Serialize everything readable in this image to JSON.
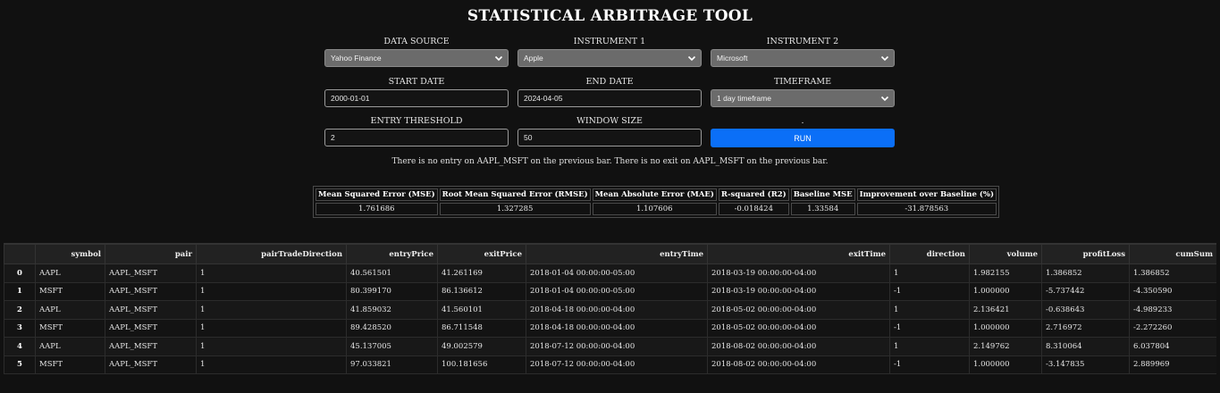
{
  "title": "STATISTICAL ARBITRAGE TOOL",
  "form": {
    "data_source": {
      "label": "DATA SOURCE",
      "value": "Yahoo Finance"
    },
    "instrument1": {
      "label": "INSTRUMENT 1",
      "value": "Apple"
    },
    "instrument2": {
      "label": "INSTRUMENT 2",
      "value": "Microsoft"
    },
    "start_date": {
      "label": "START DATE",
      "value": "2000-01-01"
    },
    "end_date": {
      "label": "END DATE",
      "value": "2024-04-05"
    },
    "timeframe": {
      "label": "TIMEFRAME",
      "value": "1 day timeframe"
    },
    "entry_threshold": {
      "label": "ENTRY THRESHOLD",
      "value": "2"
    },
    "window_size": {
      "label": "WINDOW SIZE",
      "value": "50"
    },
    "run": {
      "label": ".",
      "button": "RUN"
    }
  },
  "status": "There is no entry on AAPL_MSFT on the previous bar. There is no exit on AAPL_MSFT on the previous bar.",
  "metrics": {
    "headers": [
      "Mean Squared Error (MSE)",
      "Root Mean Squared Error (RMSE)",
      "Mean Absolute Error (MAE)",
      "R-squared (R2)",
      "Baseline MSE",
      "Improvement over Baseline (%)"
    ],
    "values": [
      "1.761686",
      "1.327285",
      "1.107606",
      "-0.018424",
      "1.33584",
      "-31.878563"
    ]
  },
  "trades": {
    "columns": [
      "",
      "symbol",
      "pair",
      "pairTradeDirection",
      "entryPrice",
      "exitPrice",
      "entryTime",
      "exitTime",
      "direction",
      "volume",
      "profitLoss",
      "cumSum"
    ],
    "rows": [
      [
        "0",
        "AAPL",
        "AAPL_MSFT",
        "1",
        "40.561501",
        "41.261169",
        "2018-01-04 00:00:00-05:00",
        "2018-03-19 00:00:00-04:00",
        "1",
        "1.982155",
        "1.386852",
        "1.386852"
      ],
      [
        "1",
        "MSFT",
        "AAPL_MSFT",
        "1",
        "80.399170",
        "86.136612",
        "2018-01-04 00:00:00-05:00",
        "2018-03-19 00:00:00-04:00",
        "-1",
        "1.000000",
        "-5.737442",
        "-4.350590"
      ],
      [
        "2",
        "AAPL",
        "AAPL_MSFT",
        "1",
        "41.859032",
        "41.560101",
        "2018-04-18 00:00:00-04:00",
        "2018-05-02 00:00:00-04:00",
        "1",
        "2.136421",
        "-0.638643",
        "-4.989233"
      ],
      [
        "3",
        "MSFT",
        "AAPL_MSFT",
        "1",
        "89.428520",
        "86.711548",
        "2018-04-18 00:00:00-04:00",
        "2018-05-02 00:00:00-04:00",
        "-1",
        "1.000000",
        "2.716972",
        "-2.272260"
      ],
      [
        "4",
        "AAPL",
        "AAPL_MSFT",
        "1",
        "45.137005",
        "49.002579",
        "2018-07-12 00:00:00-04:00",
        "2018-08-02 00:00:00-04:00",
        "1",
        "2.149762",
        "8.310064",
        "6.037804"
      ],
      [
        "5",
        "MSFT",
        "AAPL_MSFT",
        "1",
        "97.033821",
        "100.181656",
        "2018-07-12 00:00:00-04:00",
        "2018-08-02 00:00:00-04:00",
        "-1",
        "1.000000",
        "-3.147835",
        "2.889969"
      ]
    ]
  }
}
